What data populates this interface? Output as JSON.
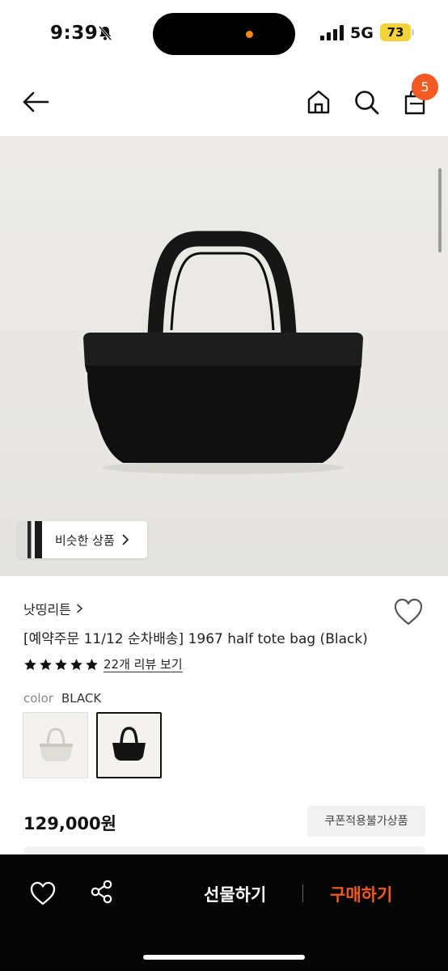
{
  "status_bar": {
    "time": "9:39",
    "network": "5G",
    "battery": "73",
    "icons": [
      "bell-off-icon",
      "signal-icon"
    ]
  },
  "header": {
    "icons": [
      "back-arrow-icon",
      "home-icon",
      "search-icon",
      "cart-icon"
    ],
    "cart_count": "5"
  },
  "hero": {
    "similar_label": "비슷한 상품"
  },
  "product": {
    "brand": "낫띵리튼",
    "title": "[예약주문 11/12 순차배송] 1967 half tote bag (Black)",
    "rating": 5,
    "review_link": "22개 리뷰 보기",
    "color_label": "color",
    "color_value": "BLACK",
    "swatches": [
      {
        "color": "#e6e4df",
        "selected": false
      },
      {
        "color": "#1a1a1a",
        "selected": true
      }
    ],
    "price": "129,000원",
    "coupon_label": "쿠폰적용불가상품"
  },
  "bottom_bar": {
    "gift_label": "선물하기",
    "buy_label": "구매하기",
    "buy_color": "#f25a22"
  }
}
